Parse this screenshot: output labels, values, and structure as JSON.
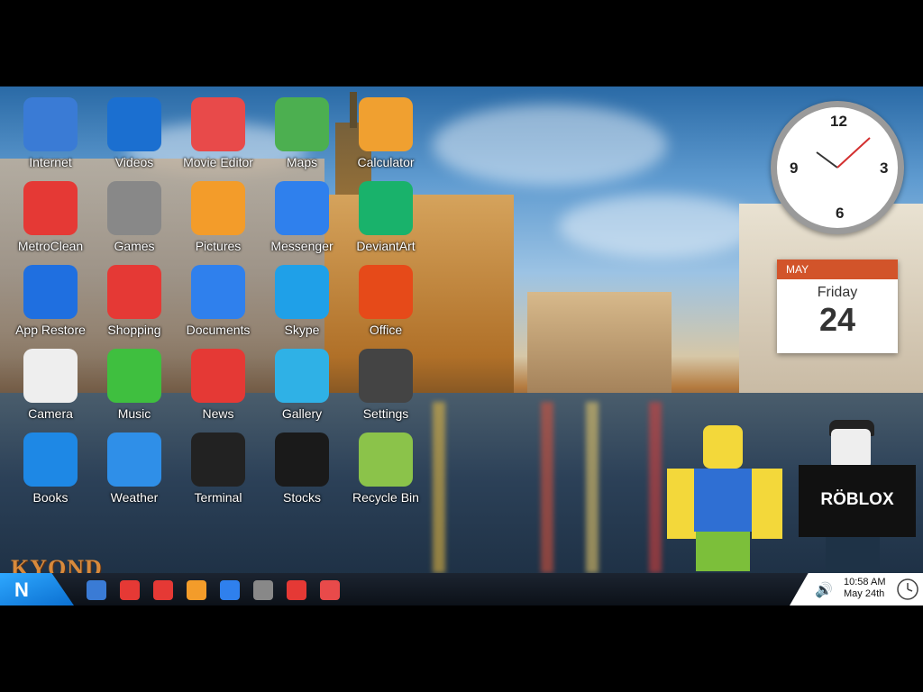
{
  "desktop_icons": [
    {
      "label": "Internet",
      "icon": "globe-icon",
      "color": "#3a7bd5"
    },
    {
      "label": "Videos",
      "icon": "clapperboard-icon",
      "color": "#1b6fd0"
    },
    {
      "label": "Movie Editor",
      "icon": "film-reel-icon",
      "color": "#e84a4a"
    },
    {
      "label": "Maps",
      "icon": "map-icon",
      "color": "#4caf50"
    },
    {
      "label": "Calculator",
      "icon": "calculator-icon",
      "color": "#f0a030"
    },
    {
      "label": "MetroClean",
      "icon": "metroclean-icon",
      "color": "#e53935"
    },
    {
      "label": "Games",
      "icon": "joystick-icon",
      "color": "#888888"
    },
    {
      "label": "Pictures",
      "icon": "picture-icon",
      "color": "#f39c2a"
    },
    {
      "label": "Messenger",
      "icon": "messenger-icon",
      "color": "#2f80ed"
    },
    {
      "label": "DeviantArt",
      "icon": "deviantart-icon",
      "color": "#19b26b"
    },
    {
      "label": "App Restore",
      "icon": "restore-icon",
      "color": "#1f6fe0"
    },
    {
      "label": "Shopping",
      "icon": "cart-icon",
      "color": "#e53935"
    },
    {
      "label": "Documents",
      "icon": "document-icon",
      "color": "#2f80ed"
    },
    {
      "label": "Skype",
      "icon": "skype-icon",
      "color": "#1fa0e8"
    },
    {
      "label": "Office",
      "icon": "office-icon",
      "color": "#e64a19"
    },
    {
      "label": "Camera",
      "icon": "camera-icon",
      "color": "#eeeeee"
    },
    {
      "label": "Music",
      "icon": "music-note-icon",
      "color": "#3fbf3f"
    },
    {
      "label": "News",
      "icon": "news-icon",
      "color": "#e53935"
    },
    {
      "label": "Gallery",
      "icon": "gallery-icon",
      "color": "#2fb1e6"
    },
    {
      "label": "Settings",
      "icon": "gear-icon",
      "color": "#444444"
    },
    {
      "label": "Books",
      "icon": "book-icon",
      "color": "#1e88e5"
    },
    {
      "label": "Weather",
      "icon": "weather-icon",
      "color": "#2f8fe8"
    },
    {
      "label": "Terminal",
      "icon": "terminal-icon",
      "color": "#222222"
    },
    {
      "label": "Stocks",
      "icon": "stocks-icon",
      "color": "#1a1a1a"
    },
    {
      "label": "Recycle Bin",
      "icon": "recycle-bin-icon",
      "color": "#8bc34a"
    }
  ],
  "clock_widget": {
    "numerals": [
      "12",
      "3",
      "6",
      "9"
    ]
  },
  "calendar_widget": {
    "month": "MAY",
    "weekday": "Friday",
    "day": "24"
  },
  "roblox_text": "RÖBLOX",
  "watermark": "KYOND",
  "taskbar": {
    "start_label": "N",
    "pinned": [
      "globe-icon",
      "metroclean-icon",
      "news-icon",
      "pictures-icon",
      "messenger-icon",
      "joystick-icon",
      "cart-icon",
      "film-reel-icon"
    ],
    "time": "10:58 AM",
    "date": "May 24th"
  },
  "colors": {
    "accent": "#1e8fe8",
    "calendar_header": "#d2542a"
  }
}
